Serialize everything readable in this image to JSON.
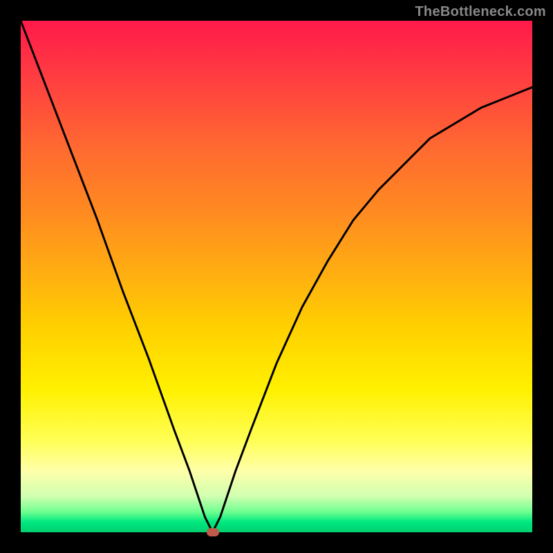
{
  "watermark": "TheBottleneck.com",
  "chart_data": {
    "type": "line",
    "title": "",
    "xlabel": "",
    "ylabel": "",
    "xlim": [
      0,
      100
    ],
    "ylim": [
      0,
      100
    ],
    "grid": false,
    "series": [
      {
        "name": "curve",
        "x": [
          0,
          5,
          10,
          15,
          20,
          25,
          30,
          33,
          35,
          36,
          37,
          37.5,
          38,
          39,
          40,
          42,
          45,
          50,
          55,
          60,
          65,
          70,
          75,
          80,
          85,
          90,
          95,
          100
        ],
        "values": [
          100,
          87,
          74,
          61,
          47,
          34,
          20,
          12,
          6,
          3,
          1,
          0,
          1,
          3,
          6,
          12,
          20,
          33,
          44,
          53,
          61,
          67,
          72,
          77,
          80,
          83,
          85,
          87
        ]
      }
    ],
    "marker": {
      "x": 37.5,
      "y": 0
    },
    "background": "rainbow-red-to-green-vertical"
  }
}
